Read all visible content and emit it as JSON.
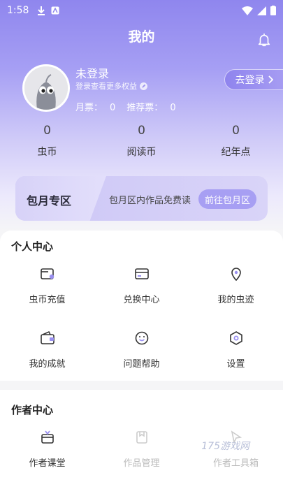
{
  "status": {
    "time": "1:58"
  },
  "header": {
    "title": "我的"
  },
  "user": {
    "name": "未登录",
    "tip": "登录查看更多权益",
    "monthly_label": "月票：",
    "monthly_value": "0",
    "recommend_label": "推荐票：",
    "recommend_value": "0",
    "login_button": "去登录"
  },
  "stats": [
    {
      "value": "0",
      "label": "虫币"
    },
    {
      "value": "0",
      "label": "阅读币"
    },
    {
      "value": "0",
      "label": "纪年点"
    }
  ],
  "vip": {
    "title": "包月专区",
    "desc": "包月区内作品免费读",
    "button": "前往包月区"
  },
  "personal": {
    "title": "个人中心",
    "items": [
      {
        "label": "虫币充值",
        "icon": "wallet-icon"
      },
      {
        "label": "兑换中心",
        "icon": "card-icon"
      },
      {
        "label": "我的虫迹",
        "icon": "location-icon"
      },
      {
        "label": "我的成就",
        "icon": "purse-icon"
      },
      {
        "label": "问题帮助",
        "icon": "smile-icon"
      },
      {
        "label": "设置",
        "icon": "settings-icon"
      }
    ]
  },
  "author": {
    "title": "作者中心",
    "items": [
      {
        "label": "作者课堂",
        "icon": "tv-icon"
      },
      {
        "label": "作品管理",
        "icon": "folder-icon"
      },
      {
        "label": "作者工具箱",
        "icon": "toolbox-icon"
      }
    ]
  },
  "watermark": "175游戏网",
  "colors": {
    "accent": "#9a90f0",
    "vip_button": "#a79ff3"
  }
}
